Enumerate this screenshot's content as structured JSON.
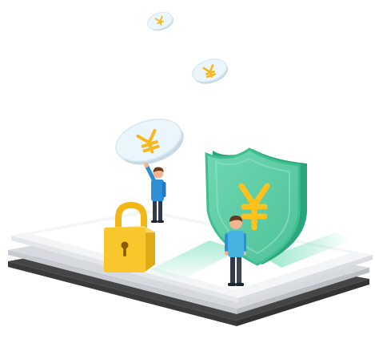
{
  "illustration": {
    "subject": "secure-payment",
    "currency_symbol": "¥",
    "colors": {
      "coin_face": "#eaf5fc",
      "coin_edge": "#c9d9e6",
      "coin_symbol": "#f5b81f",
      "shield_face": "#5ecca6",
      "shield_side": "#2aa67c",
      "shield_rim": "#3fbf8e",
      "shield_symbol": "#ffc21a",
      "lock_body": "#f9c62b",
      "lock_shadow": "#e0aa16",
      "lock_shackle": "#f2b617",
      "lock_keyhole": "#8a5c00",
      "platform_top": "#f3f5f7",
      "platform_mid": "#d6d9dd",
      "platform_bottom": "#454545",
      "person_shirt": "#2d8fd6",
      "person_shirt_light": "#44b3e0",
      "person_pants": "#2f3a4a",
      "person_hair": "#6b3a1e",
      "person_skin": "#f3b590",
      "glow": "#46d3a0"
    },
    "icons": [
      "coin-icon",
      "shield-icon",
      "padlock-icon",
      "person-icon"
    ]
  }
}
